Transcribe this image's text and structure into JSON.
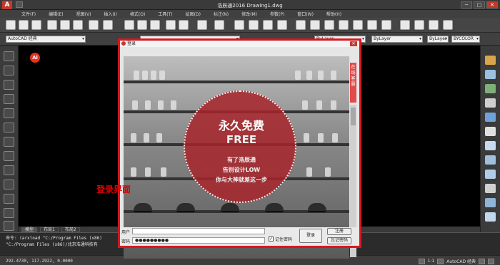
{
  "app": {
    "title": "浩辰通2016    Drawing1.dwg",
    "logo_letter": "A"
  },
  "window_buttons": {
    "minimize": "─",
    "maximize": "□",
    "close": "✕"
  },
  "menu": [
    "文件(F)",
    "编辑(E)",
    "视图(V)",
    "插入(I)",
    "格式(O)",
    "工具(T)",
    "绘图(D)",
    "标注(N)",
    "修改(M)",
    "参数(P)",
    "窗口(W)",
    "帮助(H)"
  ],
  "toolbar": {
    "workspace": "AutoCAD 经典",
    "layer_value": "0",
    "color_value": "ByLayer",
    "linetype_value": "ByLayer",
    "lineweight_value": "ByLayer",
    "plotstyle_value": "BYCOLOR"
  },
  "canvas": {
    "logo_text": "Ai"
  },
  "layout_tabs": [
    "模型",
    "布局1",
    "布局2"
  ],
  "command_lines": [
    "命令: (arxload \"C:/Program Files (x86)",
    "\"C:/Program Files (x86)/北京浩通科技有"
  ],
  "status": {
    "coords": "292.4730, 117.2922, 0.0000",
    "scale": "1:1",
    "workspace": "AutoCAD 经典"
  },
  "dialog": {
    "title": "登录",
    "close": "✕",
    "side_tab": "在线客服",
    "banner": {
      "headline": "永久免费",
      "sub": "FREE",
      "lines": [
        "有了浩辰通",
        "告别设计LOW",
        "你与大神就差这一步"
      ]
    },
    "caption": "登录界面",
    "user_label": "用户",
    "user_value": "",
    "password_label": "密码",
    "password_value": "●●●●●●●●●",
    "remember_label": "记住密码",
    "remember_checked": "✓",
    "login_button": "登录",
    "register_button": "注册",
    "forgot_button": "忘记密码"
  }
}
